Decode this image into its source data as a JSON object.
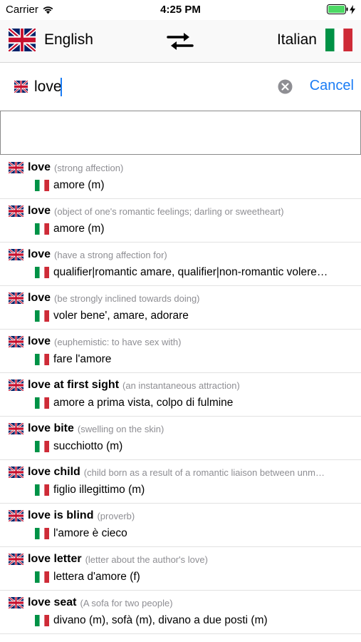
{
  "status_bar": {
    "carrier": "Carrier",
    "time": "4:25 PM"
  },
  "header": {
    "source_language": "English",
    "target_language": "Italian"
  },
  "search": {
    "query": "love",
    "cancel_label": "Cancel"
  },
  "results": [
    {
      "term": "love",
      "desc": "(strong affection)",
      "translation": "amore (m)"
    },
    {
      "term": "love",
      "desc": "(object of one's romantic feelings; darling or sweetheart)",
      "translation": "amore (m)"
    },
    {
      "term": "love",
      "desc": "(have a strong affection for)",
      "translation": "qualifier|romantic amare, qualifier|non-romantic volere…"
    },
    {
      "term": "love",
      "desc": "(be strongly inclined towards doing)",
      "translation": "voler bene', amare, adorare"
    },
    {
      "term": "love",
      "desc": "(euphemistic: to have sex with)",
      "translation": "fare l'amore"
    },
    {
      "term": "love at first sight",
      "desc": "(an instantaneous attraction)",
      "translation": "amore a prima vista, colpo di fulmine"
    },
    {
      "term": "love bite",
      "desc": "(swelling on the skin)",
      "translation": "succhiotto (m)"
    },
    {
      "term": "love child",
      "desc": "(child born as a result of a romantic liaison between unm…",
      "translation": "figlio illegittimo (m)"
    },
    {
      "term": "love is blind",
      "desc": "(proverb)",
      "translation": "l'amore è cieco"
    },
    {
      "term": "love letter",
      "desc": "(letter about the author's love)",
      "translation": "lettera d'amore (f)"
    },
    {
      "term": "love seat",
      "desc": "(A sofa for two people)",
      "translation": "divano (m), sofà (m), divano a due posti (m)"
    }
  ],
  "colors": {
    "accent": "#1a7cf5",
    "secondary_text": "#8e8e93",
    "battery": "#4cd964"
  }
}
